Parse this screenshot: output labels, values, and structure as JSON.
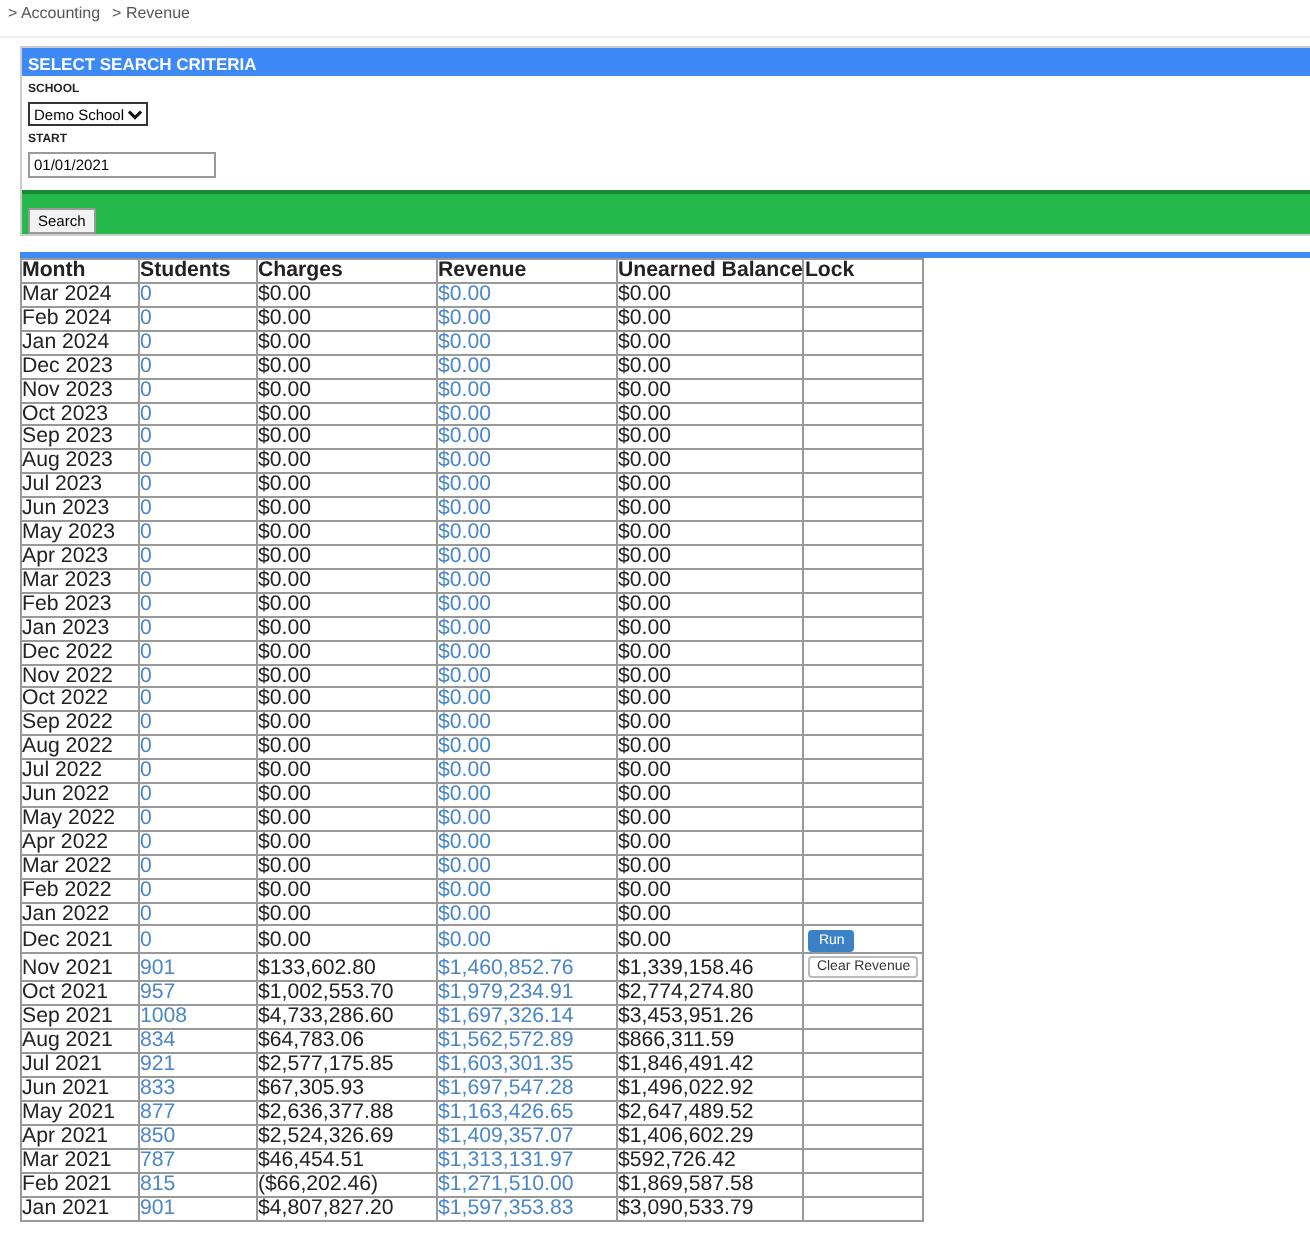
{
  "breadcrumb": [
    "> Accounting",
    "> Revenue"
  ],
  "search_panel": {
    "title": "SELECT SEARCH CRITERIA",
    "school_label": "SCHOOL",
    "school_value": "Demo School",
    "start_label": "START",
    "start_value": "01/01/2021",
    "search_button": "Search"
  },
  "table": {
    "columns": [
      "Month",
      "Students",
      "Charges",
      "Revenue",
      "Unearned Balance",
      "Lock"
    ],
    "rows": [
      {
        "month": "Mar 2024",
        "students": "0",
        "charges": "$0.00",
        "revenue": "$0.00",
        "unearned": "$0.00"
      },
      {
        "month": "Feb 2024",
        "students": "0",
        "charges": "$0.00",
        "revenue": "$0.00",
        "unearned": "$0.00"
      },
      {
        "month": "Jan 2024",
        "students": "0",
        "charges": "$0.00",
        "revenue": "$0.00",
        "unearned": "$0.00"
      },
      {
        "month": "Dec 2023",
        "students": "0",
        "charges": "$0.00",
        "revenue": "$0.00",
        "unearned": "$0.00"
      },
      {
        "month": "Nov 2023",
        "students": "0",
        "charges": "$0.00",
        "revenue": "$0.00",
        "unearned": "$0.00"
      },
      {
        "month": "Oct 2023",
        "students": "0",
        "charges": "$0.00",
        "revenue": "$0.00",
        "unearned": "$0.00"
      },
      {
        "month": "Sep 2023",
        "students": "0",
        "charges": "$0.00",
        "revenue": "$0.00",
        "unearned": "$0.00"
      },
      {
        "month": "Aug 2023",
        "students": "0",
        "charges": "$0.00",
        "revenue": "$0.00",
        "unearned": "$0.00"
      },
      {
        "month": "Jul 2023",
        "students": "0",
        "charges": "$0.00",
        "revenue": "$0.00",
        "unearned": "$0.00"
      },
      {
        "month": "Jun 2023",
        "students": "0",
        "charges": "$0.00",
        "revenue": "$0.00",
        "unearned": "$0.00"
      },
      {
        "month": "May 2023",
        "students": "0",
        "charges": "$0.00",
        "revenue": "$0.00",
        "unearned": "$0.00"
      },
      {
        "month": "Apr 2023",
        "students": "0",
        "charges": "$0.00",
        "revenue": "$0.00",
        "unearned": "$0.00"
      },
      {
        "month": "Mar 2023",
        "students": "0",
        "charges": "$0.00",
        "revenue": "$0.00",
        "unearned": "$0.00"
      },
      {
        "month": "Feb 2023",
        "students": "0",
        "charges": "$0.00",
        "revenue": "$0.00",
        "unearned": "$0.00"
      },
      {
        "month": "Jan 2023",
        "students": "0",
        "charges": "$0.00",
        "revenue": "$0.00",
        "unearned": "$0.00"
      },
      {
        "month": "Dec 2022",
        "students": "0",
        "charges": "$0.00",
        "revenue": "$0.00",
        "unearned": "$0.00"
      },
      {
        "month": "Nov 2022",
        "students": "0",
        "charges": "$0.00",
        "revenue": "$0.00",
        "unearned": "$0.00"
      },
      {
        "month": "Oct 2022",
        "students": "0",
        "charges": "$0.00",
        "revenue": "$0.00",
        "unearned": "$0.00"
      },
      {
        "month": "Sep 2022",
        "students": "0",
        "charges": "$0.00",
        "revenue": "$0.00",
        "unearned": "$0.00"
      },
      {
        "month": "Aug 2022",
        "students": "0",
        "charges": "$0.00",
        "revenue": "$0.00",
        "unearned": "$0.00"
      },
      {
        "month": "Jul 2022",
        "students": "0",
        "charges": "$0.00",
        "revenue": "$0.00",
        "unearned": "$0.00"
      },
      {
        "month": "Jun 2022",
        "students": "0",
        "charges": "$0.00",
        "revenue": "$0.00",
        "unearned": "$0.00"
      },
      {
        "month": "May 2022",
        "students": "0",
        "charges": "$0.00",
        "revenue": "$0.00",
        "unearned": "$0.00"
      },
      {
        "month": "Apr 2022",
        "students": "0",
        "charges": "$0.00",
        "revenue": "$0.00",
        "unearned": "$0.00"
      },
      {
        "month": "Mar 2022",
        "students": "0",
        "charges": "$0.00",
        "revenue": "$0.00",
        "unearned": "$0.00"
      },
      {
        "month": "Feb 2022",
        "students": "0",
        "charges": "$0.00",
        "revenue": "$0.00",
        "unearned": "$0.00"
      },
      {
        "month": "Jan 2022",
        "students": "0",
        "charges": "$0.00",
        "revenue": "$0.00",
        "unearned": "$0.00"
      },
      {
        "month": "Dec 2021",
        "students": "0",
        "charges": "$0.00",
        "revenue": "$0.00",
        "unearned": "$0.00",
        "lock": {
          "kind": "run",
          "label": "Run"
        }
      },
      {
        "month": "Nov 2021",
        "students": "901",
        "charges": "$133,602.80",
        "revenue": "$1,460,852.76",
        "unearned": "$1,339,158.46",
        "lock": {
          "kind": "clear",
          "label": "Clear Revenue"
        }
      },
      {
        "month": "Oct 2021",
        "students": "957",
        "charges": "$1,002,553.70",
        "revenue": "$1,979,234.91",
        "unearned": "$2,774,274.80"
      },
      {
        "month": "Sep 2021",
        "students": "1008",
        "charges": "$4,733,286.60",
        "revenue": "$1,697,326.14",
        "unearned": "$3,453,951.26"
      },
      {
        "month": "Aug 2021",
        "students": "834",
        "charges": "$64,783.06",
        "revenue": "$1,562,572.89",
        "unearned": "$866,311.59"
      },
      {
        "month": "Jul 2021",
        "students": "921",
        "charges": "$2,577,175.85",
        "revenue": "$1,603,301.35",
        "unearned": "$1,846,491.42"
      },
      {
        "month": "Jun 2021",
        "students": "833",
        "charges": "$67,305.93",
        "revenue": "$1,697,547.28",
        "unearned": "$1,496,022.92"
      },
      {
        "month": "May 2021",
        "students": "877",
        "charges": "$2,636,377.88",
        "revenue": "$1,163,426.65",
        "unearned": "$2,647,489.52"
      },
      {
        "month": "Apr 2021",
        "students": "850",
        "charges": "$2,524,326.69",
        "revenue": "$1,409,357.07",
        "unearned": "$1,406,602.29"
      },
      {
        "month": "Mar 2021",
        "students": "787",
        "charges": "$46,454.51",
        "revenue": "$1,313,131.97",
        "unearned": "$592,726.42"
      },
      {
        "month": "Feb 2021",
        "students": "815",
        "charges": "($66,202.46)",
        "revenue": "$1,271,510.00",
        "unearned": "$1,869,587.58"
      },
      {
        "month": "Jan 2021",
        "students": "901",
        "charges": "$4,807,827.20",
        "revenue": "$1,597,353.83",
        "unearned": "$3,090,533.79"
      }
    ]
  }
}
